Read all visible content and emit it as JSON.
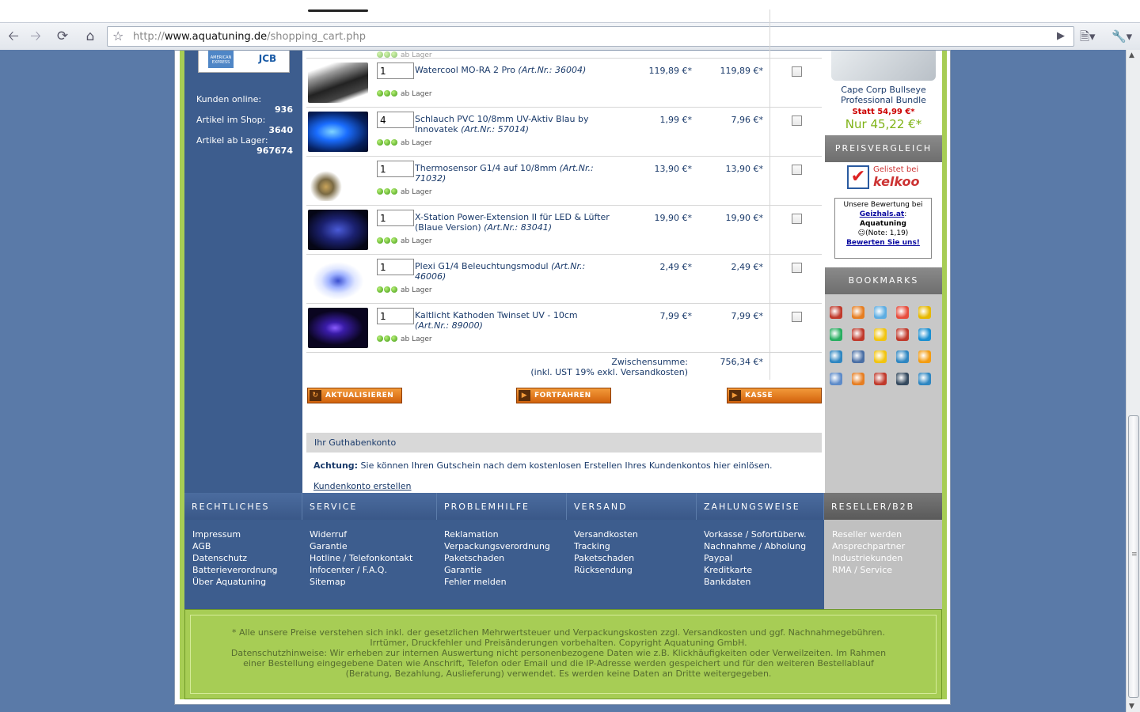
{
  "browser": {
    "url_prefix": "http://",
    "url_domain": "www.aquatuning.de",
    "url_path": "/shopping_cart.php"
  },
  "sidebar_left": {
    "card_amex": "AMERICAN EXPRESS",
    "card_jcb": "JCB",
    "stats": [
      {
        "label": "Kunden online:",
        "value": "936"
      },
      {
        "label": "Artikel im Shop:",
        "value": "3640"
      },
      {
        "label": "Artikel ab Lager:",
        "value": "967674"
      }
    ]
  },
  "cart": {
    "partial_row_avail": "ab Lager",
    "items": [
      {
        "qty": "1",
        "name": "Watercool MO-RA 2 Pro ",
        "artnr": "(Art.Nr.: 36004)",
        "avail": "ab Lager",
        "price": "119,89 €*",
        "total": "119,89 €*"
      },
      {
        "qty": "4",
        "name": "Schlauch PVC 10/8mm UV-Aktiv Blau by Innovatek ",
        "artnr": "(Art.Nr.: 57014)",
        "avail": "ab Lager",
        "price": "1,99 €*",
        "total": "7,96 €*"
      },
      {
        "qty": "1",
        "name": "Thermosensor G1/4 auf 10/8mm ",
        "artnr": "(Art.Nr.: 71032)",
        "avail": "ab Lager",
        "price": "13,90 €*",
        "total": "13,90 €*"
      },
      {
        "qty": "1",
        "name": "X-Station Power-Extension II für LED & Lüfter (Blaue Version) ",
        "artnr": "(Art.Nr.: 83041)",
        "avail": "ab Lager",
        "price": "19,90 €*",
        "total": "19,90 €*"
      },
      {
        "qty": "1",
        "name": "Plexi G1/4 Beleuchtungsmodul ",
        "artnr": "(Art.Nr.: 46006)",
        "avail": "ab Lager",
        "price": "2,49 €*",
        "total": "2,49 €*"
      },
      {
        "qty": "1",
        "name": "Kaltlicht Kathoden Twinset UV - 10cm ",
        "artnr": "(Art.Nr.: 89000)",
        "avail": "ab Lager",
        "price": "7,99 €*",
        "total": "7,99 €*"
      }
    ],
    "subtotal_label": "Zwischensumme:",
    "subtotal_note_prefix": "(inkl. UST 19% exkl. ",
    "subtotal_note_link": "Versandkosten",
    "subtotal_note_suffix": ")",
    "subtotal_value": "756,34 €*",
    "buttons": {
      "update": "AKTUALISIEREN",
      "continue": "FORTFAHREN",
      "checkout": "KASSE"
    },
    "guthaben_title": "Ihr Guthabenkonto",
    "achtung_bold": "Achtung:",
    "achtung_text": " Sie können Ihren Gutschein nach dem kostenlosen Erstellen Ihres Kundenkontos hier einlösen.",
    "create_account": "Kundenkonto erstellen"
  },
  "sidebar_right": {
    "promo_name": "Cape Corp Bullseye Professional Bundle",
    "promo_statt": "Statt 54,99 €*",
    "promo_nur": "Nur 45,22 €*",
    "preisvergleich_title": "PREISVERGLEICH",
    "kelkoo_line1": "Gelistet bei",
    "kelkoo_line2": "kelkoo",
    "geizhals_line1": "Unsere Bewertung bei",
    "geizhals_link": "Geizhals.at",
    "geizhals_colon": ":",
    "geizhals_shop": "Aquatuning",
    "geizhals_note": "(Note: 1,19)",
    "geizhals_rate": "Bewerten Sie uns!",
    "bookmarks_title": "BOOKMARKS",
    "bookmark_icons": [
      "mister-wong-icon",
      "furl-icon",
      "oneview-icon",
      "windows-live-icon",
      "ask-icon",
      "yigg-icon",
      "linkarena-icon",
      "favorites-icon",
      "del-icio-us-icon",
      "technorati-icon",
      "webnews-icon",
      "google-icon",
      "folkd-icon",
      "seekxl-icon",
      "flickr-icon",
      "blinklist-icon",
      "stumbleupon-icon",
      "yahoo-icon",
      "newsvine-icon",
      "icio-icon"
    ],
    "bookmark_colors": [
      "#c0392b",
      "#e67e22",
      "#5dade2",
      "#e74c3c",
      "#e6b800",
      "#27ae60",
      "#c0392b",
      "#f1c40f",
      "#c0392b",
      "#1a8fd1",
      "#2e86c1",
      "#4a6fa5",
      "#f1c40f",
      "#2e86c1",
      "#f39c12",
      "#5d8bc9",
      "#e67e22",
      "#c0392b",
      "#34495e",
      "#2e86c1"
    ]
  },
  "footer": {
    "columns": [
      {
        "title": "RECHTLICHES",
        "links": [
          "Impressum",
          "AGB",
          "Datenschutz",
          "Batterieverordnung",
          "Über Aquatuning"
        ]
      },
      {
        "title": "SERVICE",
        "links": [
          "Widerruf",
          "Garantie",
          "Hotline / Telefonkontakt",
          "Infocenter / F.A.Q.",
          "Sitemap"
        ]
      },
      {
        "title": "PROBLEMHILFE",
        "links": [
          "Reklamation",
          "Verpackungsverordnung",
          "Paketschaden",
          "Garantie",
          "Fehler melden"
        ]
      },
      {
        "title": "VERSAND",
        "links": [
          "Versandkosten",
          "Tracking",
          "Paketschaden",
          "Rücksendung"
        ]
      },
      {
        "title": "ZAHLUNGSWEISE",
        "links": [
          "Vorkasse / Sofortüberw.",
          "Nachnahme / Abholung",
          "Paypal",
          "Kreditkarte",
          "Bankdaten"
        ]
      },
      {
        "title": "RESELLER/B2B",
        "links": [
          "Reseller werden",
          "Ansprechpartner",
          "Industriekunden",
          "RMA / Service"
        ]
      }
    ],
    "legal_lines": [
      "* Alle unsere Preise verstehen sich inkl. der gesetzlichen Mehrwertsteuer und Verpackungskosten zzgl. Versandkosten und ggf. Nachnahmegebühren.",
      "Irrtümer, Druckfehler und Preisänderungen vorbehalten. Copyright Aquatuning GmbH.",
      "Datenschutzhinweise: Wir erheben zur internen Auswertung nicht personenbezogene Daten wie z.B. Klickhäufigkeiten oder Verweilzeiten. Im Rahmen",
      "einer Bestellung eingegebene Daten wie Anschrift, Telefon oder Email und die IP-Adresse werden gespeichert und für den weiteren Bestellablauf",
      "(Beratung, Bezahlung, Auslieferung) verwendet. Es werden keine Daten an Dritte weitergegeben."
    ]
  }
}
